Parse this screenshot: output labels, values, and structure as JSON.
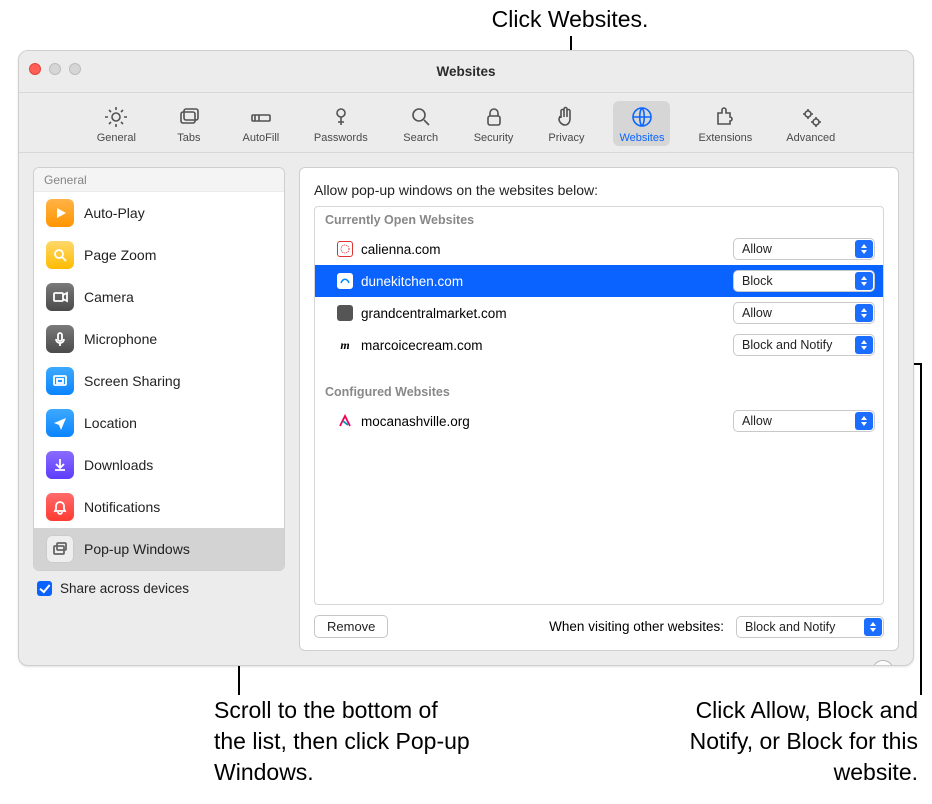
{
  "callouts": {
    "top": "Click Websites.",
    "bottom_left": "Scroll to the bottom of the list, then click Pop-up Windows.",
    "bottom_right": "Click Allow, Block and Notify, or Block for this website."
  },
  "window": {
    "title": "Websites"
  },
  "toolbar": {
    "items": [
      {
        "label": "General"
      },
      {
        "label": "Tabs"
      },
      {
        "label": "AutoFill"
      },
      {
        "label": "Passwords"
      },
      {
        "label": "Search"
      },
      {
        "label": "Security"
      },
      {
        "label": "Privacy"
      },
      {
        "label": "Websites"
      },
      {
        "label": "Extensions"
      },
      {
        "label": "Advanced"
      }
    ],
    "active_index": 7
  },
  "sidebar": {
    "section_label": "General",
    "items": [
      {
        "label": "Auto-Play"
      },
      {
        "label": "Page Zoom"
      },
      {
        "label": "Camera"
      },
      {
        "label": "Microphone"
      },
      {
        "label": "Screen Sharing"
      },
      {
        "label": "Location"
      },
      {
        "label": "Downloads"
      },
      {
        "label": "Notifications"
      },
      {
        "label": "Pop-up Windows"
      }
    ],
    "selected_index": 8
  },
  "share_checkbox": {
    "label": "Share across devices",
    "checked": true
  },
  "main": {
    "heading": "Allow pop-up windows on the websites below:",
    "open_section": "Currently Open Websites",
    "configured_section": "Configured Websites",
    "open_rows": [
      {
        "site": "calienna.com",
        "value": "Allow"
      },
      {
        "site": "dunekitchen.com",
        "value": "Block"
      },
      {
        "site": "grandcentralmarket.com",
        "value": "Allow"
      },
      {
        "site": "marcoicecream.com",
        "value": "Block and Notify"
      }
    ],
    "open_selected_index": 1,
    "configured_rows": [
      {
        "site": "mocanashville.org",
        "value": "Allow"
      }
    ],
    "remove_label": "Remove",
    "other_label": "When visiting other websites:",
    "other_value": "Block and Notify",
    "popup_options": [
      "Allow",
      "Block and Notify",
      "Block"
    ]
  },
  "help_label": "?"
}
